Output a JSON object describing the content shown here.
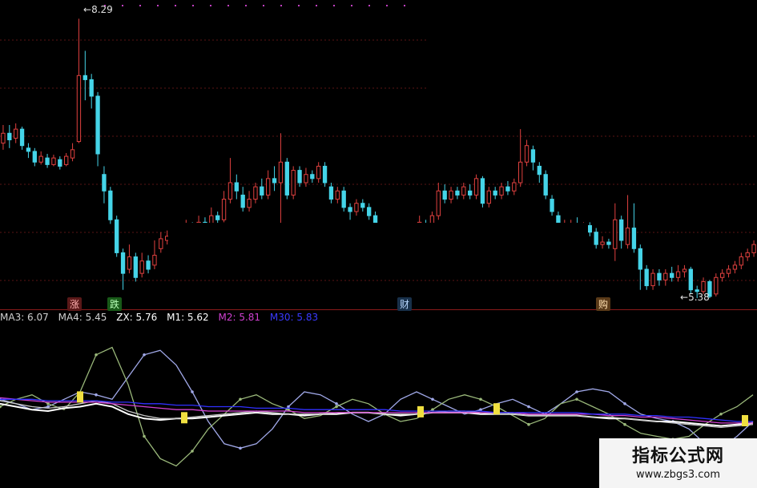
{
  "chart_data": [
    {
      "type": "candlestick",
      "title": "",
      "price_labels": {
        "high": "8.29",
        "low": "5.38"
      },
      "markers": [
        {
          "label": "涨",
          "color": "#d84a4a"
        },
        {
          "label": "跌",
          "color": "#2db52d"
        },
        {
          "label": "财",
          "color": "#4a8ee8"
        },
        {
          "label": "购",
          "color": "#e0a040"
        }
      ],
      "up_color": "#e0413f",
      "down_color": "#45d4e8",
      "ylim": [
        4.9,
        8.4
      ],
      "candles": [
        {
          "o": 6.78,
          "c": 6.9,
          "h": 7.0,
          "l": 6.7
        },
        {
          "o": 6.9,
          "c": 6.82,
          "h": 7.0,
          "l": 6.72
        },
        {
          "o": 6.84,
          "c": 6.95,
          "h": 7.02,
          "l": 6.78
        },
        {
          "o": 6.95,
          "c": 6.75,
          "h": 6.98,
          "l": 6.7
        },
        {
          "o": 6.72,
          "c": 6.68,
          "h": 6.78,
          "l": 6.6
        },
        {
          "o": 6.68,
          "c": 6.55,
          "h": 6.72,
          "l": 6.5
        },
        {
          "o": 6.55,
          "c": 6.62,
          "h": 6.68,
          "l": 6.52
        },
        {
          "o": 6.6,
          "c": 6.52,
          "h": 6.65,
          "l": 6.48
        },
        {
          "o": 6.52,
          "c": 6.6,
          "h": 6.64,
          "l": 6.5
        },
        {
          "o": 6.58,
          "c": 6.5,
          "h": 6.62,
          "l": 6.46
        },
        {
          "o": 6.52,
          "c": 6.62,
          "h": 6.66,
          "l": 6.5
        },
        {
          "o": 6.6,
          "c": 6.7,
          "h": 6.78,
          "l": 6.56
        },
        {
          "o": 6.8,
          "c": 7.6,
          "h": 8.29,
          "l": 6.78
        },
        {
          "o": 7.6,
          "c": 7.55,
          "h": 7.9,
          "l": 7.3
        },
        {
          "o": 7.55,
          "c": 7.35,
          "h": 7.62,
          "l": 7.2
        },
        {
          "o": 7.35,
          "c": 6.65,
          "h": 7.4,
          "l": 6.5
        },
        {
          "o": 6.4,
          "c": 6.2,
          "h": 6.5,
          "l": 6.05
        },
        {
          "o": 6.2,
          "c": 5.85,
          "h": 6.25,
          "l": 5.8
        },
        {
          "o": 5.85,
          "c": 5.45,
          "h": 5.9,
          "l": 5.4
        },
        {
          "o": 5.45,
          "c": 5.2,
          "h": 5.5,
          "l": 5.0
        },
        {
          "o": 5.25,
          "c": 5.4,
          "h": 5.55,
          "l": 5.2
        },
        {
          "o": 5.4,
          "c": 5.15,
          "h": 5.45,
          "l": 5.1
        },
        {
          "o": 5.2,
          "c": 5.35,
          "h": 5.45,
          "l": 5.15
        },
        {
          "o": 5.35,
          "c": 5.25,
          "h": 5.42,
          "l": 5.2
        },
        {
          "o": 5.3,
          "c": 5.42,
          "h": 5.6,
          "l": 5.25
        },
        {
          "o": 5.5,
          "c": 5.62,
          "h": 5.7,
          "l": 5.45
        },
        {
          "o": 5.6,
          "c": 5.65,
          "h": 5.72,
          "l": 5.55
        },
        {
          "o": 5.65,
          "c": 5.7,
          "h": 5.78,
          "l": 5.6
        },
        {
          "o": 5.68,
          "c": 5.62,
          "h": 5.75,
          "l": 5.55
        },
        {
          "o": 5.62,
          "c": 5.75,
          "h": 5.85,
          "l": 5.6
        },
        {
          "o": 5.75,
          "c": 5.72,
          "h": 5.82,
          "l": 5.65
        },
        {
          "o": 5.72,
          "c": 5.82,
          "h": 5.9,
          "l": 5.68
        },
        {
          "o": 5.82,
          "c": 5.75,
          "h": 5.88,
          "l": 5.7
        },
        {
          "o": 5.78,
          "c": 5.9,
          "h": 6.0,
          "l": 5.75
        },
        {
          "o": 5.9,
          "c": 5.85,
          "h": 5.95,
          "l": 5.8
        },
        {
          "o": 5.85,
          "c": 6.1,
          "h": 6.2,
          "l": 5.82
        },
        {
          "o": 6.1,
          "c": 6.3,
          "h": 6.6,
          "l": 6.05
        },
        {
          "o": 6.3,
          "c": 6.2,
          "h": 6.4,
          "l": 6.1
        },
        {
          "o": 6.15,
          "c": 6.0,
          "h": 6.25,
          "l": 5.95
        },
        {
          "o": 6.0,
          "c": 6.1,
          "h": 6.2,
          "l": 5.95
        },
        {
          "o": 6.1,
          "c": 6.25,
          "h": 6.3,
          "l": 6.05
        },
        {
          "o": 6.25,
          "c": 6.15,
          "h": 6.35,
          "l": 6.1
        },
        {
          "o": 6.15,
          "c": 6.35,
          "h": 6.45,
          "l": 6.1
        },
        {
          "o": 6.35,
          "c": 6.3,
          "h": 6.5,
          "l": 6.2
        },
        {
          "o": 6.3,
          "c": 6.55,
          "h": 6.9,
          "l": 5.7
        },
        {
          "o": 6.55,
          "c": 6.15,
          "h": 6.6,
          "l": 6.1
        },
        {
          "o": 6.15,
          "c": 6.45,
          "h": 6.5,
          "l": 6.1
        },
        {
          "o": 6.45,
          "c": 6.3,
          "h": 6.5,
          "l": 6.25
        },
        {
          "o": 6.3,
          "c": 6.4,
          "h": 6.48,
          "l": 6.25
        },
        {
          "o": 6.4,
          "c": 6.35,
          "h": 6.45,
          "l": 6.3
        },
        {
          "o": 6.35,
          "c": 6.5,
          "h": 6.55,
          "l": 6.3
        },
        {
          "o": 6.5,
          "c": 6.3,
          "h": 6.55,
          "l": 6.25
        },
        {
          "o": 6.25,
          "c": 6.1,
          "h": 6.3,
          "l": 6.05
        },
        {
          "o": 6.1,
          "c": 6.2,
          "h": 6.25,
          "l": 6.05
        },
        {
          "o": 6.2,
          "c": 6.0,
          "h": 6.25,
          "l": 5.95
        },
        {
          "o": 6.0,
          "c": 5.95,
          "h": 6.05,
          "l": 5.85
        },
        {
          "o": 5.95,
          "c": 6.05,
          "h": 6.1,
          "l": 5.9
        },
        {
          "o": 6.05,
          "c": 6.0,
          "h": 6.1,
          "l": 5.95
        },
        {
          "o": 6.0,
          "c": 5.9,
          "h": 6.05,
          "l": 5.85
        },
        {
          "o": 5.9,
          "c": 5.7,
          "h": 5.95,
          "l": 5.65
        },
        {
          "o": 5.72,
          "c": 5.62,
          "h": 5.8,
          "l": 5.58
        },
        {
          "o": 5.62,
          "c": 5.7,
          "h": 5.75,
          "l": 5.6
        },
        {
          "o": 5.7,
          "c": 5.65,
          "h": 5.75,
          "l": 5.6
        },
        {
          "o": 5.65,
          "c": 5.75,
          "h": 5.8,
          "l": 5.6
        },
        {
          "o": 5.75,
          "c": 5.7,
          "h": 5.8,
          "l": 5.65
        },
        {
          "o": 5.7,
          "c": 5.75,
          "h": 5.8,
          "l": 5.65
        },
        {
          "o": 5.75,
          "c": 5.82,
          "h": 5.9,
          "l": 5.7
        },
        {
          "o": 5.8,
          "c": 5.7,
          "h": 5.85,
          "l": 5.65
        },
        {
          "o": 5.72,
          "c": 5.9,
          "h": 5.95,
          "l": 5.7
        },
        {
          "o": 5.9,
          "c": 6.2,
          "h": 6.3,
          "l": 5.85
        },
        {
          "o": 6.2,
          "c": 6.1,
          "h": 6.28,
          "l": 6.05
        },
        {
          "o": 6.1,
          "c": 6.2,
          "h": 6.25,
          "l": 6.05
        },
        {
          "o": 6.2,
          "c": 6.15,
          "h": 6.25,
          "l": 6.1
        },
        {
          "o": 6.15,
          "c": 6.25,
          "h": 6.3,
          "l": 6.1
        },
        {
          "o": 6.2,
          "c": 6.15,
          "h": 6.28,
          "l": 6.1
        },
        {
          "o": 6.15,
          "c": 6.35,
          "h": 6.4,
          "l": 6.1
        },
        {
          "o": 6.35,
          "c": 6.05,
          "h": 6.38,
          "l": 6.0
        },
        {
          "o": 6.05,
          "c": 6.2,
          "h": 6.25,
          "l": 6.0
        },
        {
          "o": 6.2,
          "c": 6.15,
          "h": 6.25,
          "l": 6.1
        },
        {
          "o": 6.15,
          "c": 6.25,
          "h": 6.3,
          "l": 6.1
        },
        {
          "o": 6.25,
          "c": 6.2,
          "h": 6.32,
          "l": 6.15
        },
        {
          "o": 6.2,
          "c": 6.3,
          "h": 6.35,
          "l": 6.15
        },
        {
          "o": 6.3,
          "c": 6.55,
          "h": 6.95,
          "l": 6.25
        },
        {
          "o": 6.55,
          "c": 6.75,
          "h": 6.82,
          "l": 6.5
        },
        {
          "o": 6.7,
          "c": 6.55,
          "h": 6.75,
          "l": 6.45
        },
        {
          "o": 6.5,
          "c": 6.4,
          "h": 6.55,
          "l": 6.3
        },
        {
          "o": 6.4,
          "c": 6.15,
          "h": 6.45,
          "l": 6.1
        },
        {
          "o": 6.1,
          "c": 5.95,
          "h": 6.15,
          "l": 5.9
        },
        {
          "o": 5.9,
          "c": 5.6,
          "h": 5.95,
          "l": 5.55
        },
        {
          "o": 5.6,
          "c": 5.75,
          "h": 5.85,
          "l": 5.55
        },
        {
          "o": 5.75,
          "c": 5.8,
          "h": 5.85,
          "l": 5.7
        },
        {
          "o": 5.8,
          "c": 5.75,
          "h": 5.88,
          "l": 5.7
        },
        {
          "o": 5.75,
          "c": 5.78,
          "h": 5.82,
          "l": 5.7
        },
        {
          "o": 5.78,
          "c": 5.7,
          "h": 5.82,
          "l": 5.65
        },
        {
          "o": 5.7,
          "c": 5.55,
          "h": 5.75,
          "l": 5.5
        },
        {
          "o": 5.55,
          "c": 5.58,
          "h": 5.65,
          "l": 5.5
        },
        {
          "o": 5.58,
          "c": 5.55,
          "h": 5.62,
          "l": 5.5
        },
        {
          "o": 5.5,
          "c": 5.85,
          "h": 6.05,
          "l": 5.35
        },
        {
          "o": 5.85,
          "c": 5.6,
          "h": 5.9,
          "l": 5.5
        },
        {
          "o": 5.55,
          "c": 5.75,
          "h": 6.15,
          "l": 5.5
        },
        {
          "o": 5.75,
          "c": 5.5,
          "h": 6.05,
          "l": 5.45
        },
        {
          "o": 5.5,
          "c": 5.25,
          "h": 5.55,
          "l": 5.0
        },
        {
          "o": 5.25,
          "c": 5.05,
          "h": 5.3,
          "l": 5.0
        },
        {
          "o": 5.05,
          "c": 5.2,
          "h": 5.25,
          "l": 5.0
        },
        {
          "o": 5.2,
          "c": 5.12,
          "h": 5.25,
          "l": 5.05
        },
        {
          "o": 5.12,
          "c": 5.2,
          "h": 5.25,
          "l": 5.05
        },
        {
          "o": 5.2,
          "c": 5.15,
          "h": 5.28,
          "l": 5.1
        },
        {
          "o": 5.15,
          "c": 5.22,
          "h": 5.3,
          "l": 5.1
        },
        {
          "o": 5.22,
          "c": 5.25,
          "h": 5.3,
          "l": 5.15
        },
        {
          "o": 5.25,
          "c": 5.0,
          "h": 5.28,
          "l": 4.95
        },
        {
          "o": 5.0,
          "c": 4.98,
          "h": 5.05,
          "l": 4.9
        },
        {
          "o": 4.98,
          "c": 5.1,
          "h": 5.15,
          "l": 4.95
        },
        {
          "o": 5.1,
          "c": 4.92,
          "h": 5.12,
          "l": 4.9
        },
        {
          "o": 4.95,
          "c": 5.15,
          "h": 5.2,
          "l": 4.92
        },
        {
          "o": 5.15,
          "c": 5.2,
          "h": 5.25,
          "l": 5.1
        },
        {
          "o": 5.2,
          "c": 5.25,
          "h": 5.3,
          "l": 5.15
        },
        {
          "o": 5.25,
          "c": 5.3,
          "h": 5.35,
          "l": 5.2
        },
        {
          "o": 5.3,
          "c": 5.4,
          "h": 5.45,
          "l": 5.25
        },
        {
          "o": 5.4,
          "c": 5.45,
          "h": 5.5,
          "l": 5.35
        },
        {
          "o": 5.45,
          "c": 5.55,
          "h": 5.6,
          "l": 5.4
        }
      ]
    },
    {
      "type": "line",
      "title": "",
      "legend_items": [
        {
          "text": "MA3: 6.07",
          "color": "#d0d0d0"
        },
        {
          "text": "MA4: 5.45",
          "color": "#d0d0d0"
        },
        {
          "text": "ZX: 5.76",
          "color": "#ffffff"
        },
        {
          "text": "M1: 5.62",
          "color": "#ffffff"
        },
        {
          "text": "M2: 5.81",
          "color": "#d040d0"
        },
        {
          "text": "M30: 5.83",
          "color": "#3a3aff"
        }
      ],
      "ylim": [
        0,
        100
      ],
      "x": [
        0,
        20,
        40,
        60,
        80,
        100,
        120,
        140,
        160,
        180,
        200,
        220,
        240,
        260,
        280,
        300,
        320,
        340,
        360,
        380,
        400,
        420,
        440,
        460,
        480,
        500,
        520,
        540,
        560,
        580,
        600,
        620,
        640,
        660,
        680,
        700,
        720,
        740,
        760,
        780,
        800,
        820,
        840,
        860,
        880,
        900,
        920,
        940
      ],
      "series": [
        {
          "name": "MA3",
          "color": "#a0a8e8",
          "values": [
            55,
            52,
            48,
            50,
            55,
            60,
            58,
            55,
            70,
            85,
            88,
            78,
            60,
            40,
            25,
            22,
            25,
            35,
            50,
            60,
            58,
            52,
            45,
            40,
            45,
            55,
            60,
            55,
            50,
            45,
            48,
            52,
            55,
            50,
            45,
            52,
            60,
            62,
            60,
            52,
            45,
            42,
            40,
            35,
            25,
            22,
            30,
            40
          ]
        },
        {
          "name": "MA4",
          "color": "#9ab87a",
          "values": [
            50,
            55,
            58,
            52,
            48,
            60,
            85,
            90,
            65,
            30,
            15,
            10,
            20,
            35,
            45,
            55,
            58,
            52,
            48,
            42,
            44,
            50,
            55,
            52,
            45,
            40,
            42,
            48,
            55,
            58,
            55,
            50,
            44,
            38,
            42,
            52,
            55,
            50,
            45,
            38,
            32,
            30,
            28,
            30,
            38,
            45,
            50,
            58
          ]
        },
        {
          "name": "ZX",
          "color": "#ffffff",
          "values": [
            52,
            50,
            48,
            47,
            49,
            50,
            52,
            50,
            45,
            42,
            41,
            42,
            42,
            43,
            44,
            45,
            46,
            45,
            45,
            44,
            45,
            45,
            46,
            46,
            45,
            44,
            45,
            46,
            46,
            46,
            45,
            45,
            45,
            44,
            44,
            44,
            44,
            43,
            42,
            42,
            41,
            40,
            40,
            39,
            38,
            37,
            38,
            39
          ]
        },
        {
          "name": "M1",
          "color": "#c8c8c8",
          "values": [
            54,
            52,
            50,
            49,
            50,
            52,
            54,
            52,
            47,
            44,
            42,
            42,
            43,
            44,
            45,
            46,
            47,
            46,
            45,
            45,
            45,
            46,
            46,
            46,
            45,
            45,
            45,
            46,
            47,
            47,
            46,
            45,
            45,
            44,
            44,
            44,
            44,
            43,
            43,
            42,
            41,
            40,
            39,
            38,
            37,
            36,
            37,
            38
          ]
        },
        {
          "name": "M2",
          "color": "#d040d0",
          "values": [
            56,
            55,
            54,
            53,
            53,
            53,
            53,
            52,
            51,
            50,
            49,
            48,
            48,
            47,
            47,
            47,
            47,
            47,
            47,
            46,
            46,
            46,
            46,
            46,
            46,
            46,
            46,
            46,
            46,
            46,
            46,
            46,
            46,
            45,
            45,
            45,
            45,
            45,
            44,
            44,
            43,
            43,
            42,
            41,
            40,
            39,
            39,
            39
          ]
        },
        {
          "name": "M30",
          "color": "#3030ff",
          "values": [
            55,
            55,
            55,
            54,
            54,
            54,
            54,
            53,
            53,
            52,
            52,
            51,
            51,
            50,
            50,
            50,
            49,
            49,
            49,
            48,
            48,
            48,
            48,
            48,
            48,
            47,
            47,
            47,
            47,
            47,
            47,
            46,
            46,
            46,
            46,
            46,
            46,
            45,
            45,
            45,
            44,
            44,
            43,
            43,
            42,
            41,
            40,
            40
          ]
        }
      ],
      "signals": [
        {
          "x": 100,
          "y": 56
        },
        {
          "x": 230,
          "y": 42
        },
        {
          "x": 525,
          "y": 46
        },
        {
          "x": 620,
          "y": 48
        },
        {
          "x": 930,
          "y": 40
        }
      ]
    }
  ],
  "watermark": {
    "title": "指标公式网",
    "url": "www.zbgs3.com"
  }
}
